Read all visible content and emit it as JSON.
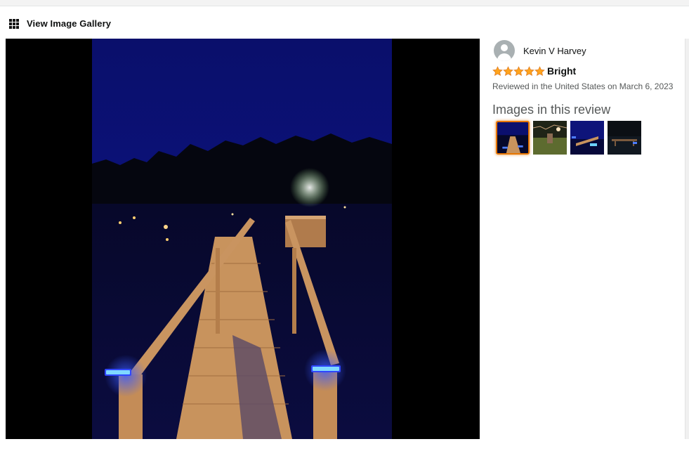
{
  "gallery": {
    "link_label": "View Image Gallery",
    "icon": "grid-icon"
  },
  "review": {
    "reviewer_name": "Kevin V Harvey",
    "rating": 5,
    "rating_max": 5,
    "title": "Bright",
    "meta": "Reviewed in the United States on March 6, 2023",
    "images_heading": "Images in this review",
    "thumbnails": [
      {
        "label": "thumbnail-1",
        "selected": true
      },
      {
        "label": "thumbnail-2",
        "selected": false
      },
      {
        "label": "thumbnail-3",
        "selected": false
      },
      {
        "label": "thumbnail-4",
        "selected": false
      }
    ]
  },
  "colors": {
    "star": "#ffa41c",
    "star_border": "#de7921",
    "selected_border": "#e77600",
    "meta_text": "#565959"
  }
}
